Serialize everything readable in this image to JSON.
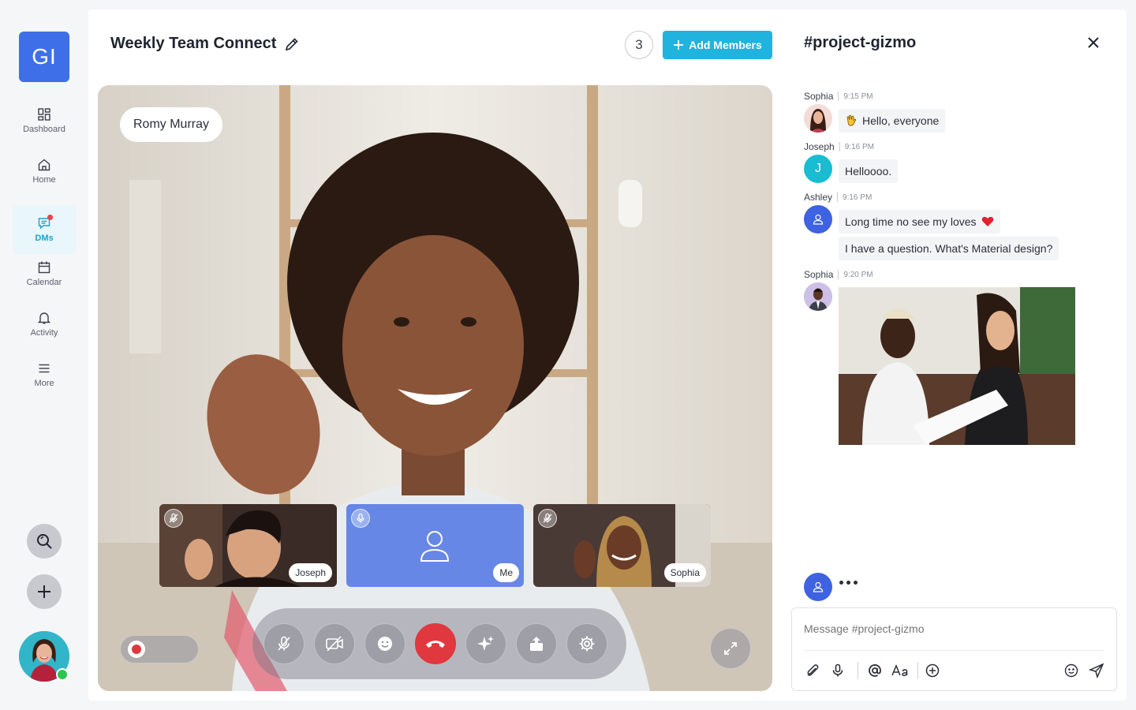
{
  "rail": {
    "logo": "GI",
    "items": [
      {
        "label": "Dashboard",
        "icon": "grid-icon"
      },
      {
        "label": "Home",
        "icon": "home-icon"
      },
      {
        "label": "DMs",
        "icon": "chat-icon"
      },
      {
        "label": "Calendar",
        "icon": "calendar-icon"
      },
      {
        "label": "Activity",
        "icon": "bell-icon"
      },
      {
        "label": "More",
        "icon": "menu-icon"
      }
    ],
    "active": "DMs"
  },
  "call": {
    "title": "Weekly Team Connect",
    "participant_count": "3",
    "add_members_label": "Add Members",
    "speaker_name": "Romy Murray",
    "tiles": [
      {
        "name": "Joseph",
        "muted": true
      },
      {
        "name": "Me",
        "muted": false
      },
      {
        "name": "Sophia",
        "muted": true
      }
    ]
  },
  "channel": {
    "title": "#project-gizmo",
    "messages": [
      {
        "author": "Sophia",
        "time": "9:15 PM",
        "lines": [
          "Hello, everyone"
        ],
        "emoji": "waving-hand"
      },
      {
        "author": "Joseph",
        "time": "9:16 PM",
        "initial": "J",
        "lines": [
          "Helloooo."
        ]
      },
      {
        "author": "Ashley",
        "time": "9:16 PM",
        "lines": [
          "Long time no see my loves",
          "I have a question. What's Material design?"
        ],
        "emoji": "red-heart"
      },
      {
        "author": "Sophia",
        "time": "9:20 PM",
        "attachment": "photo"
      }
    ],
    "composer_placeholder": "Message #project-gizmo"
  },
  "colors": {
    "brand": "#3f6fe8",
    "accent": "#20b3dd",
    "end_call": "#e0383e",
    "online": "#2ec44e"
  }
}
